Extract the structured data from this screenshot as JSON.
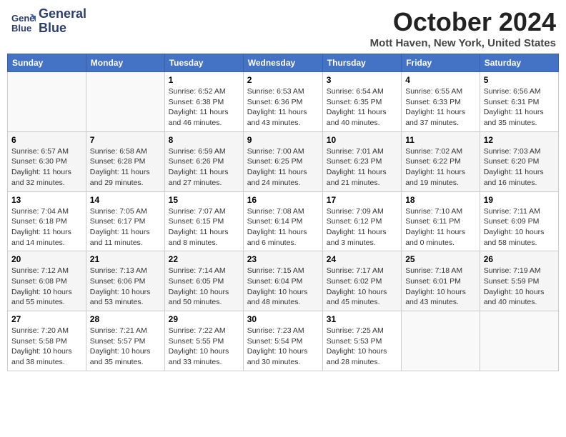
{
  "header": {
    "logo_line1": "General",
    "logo_line2": "Blue",
    "month": "October 2024",
    "location": "Mott Haven, New York, United States"
  },
  "days_of_week": [
    "Sunday",
    "Monday",
    "Tuesday",
    "Wednesday",
    "Thursday",
    "Friday",
    "Saturday"
  ],
  "weeks": [
    [
      {
        "day": "",
        "sunrise": "",
        "sunset": "",
        "daylight": ""
      },
      {
        "day": "",
        "sunrise": "",
        "sunset": "",
        "daylight": ""
      },
      {
        "day": "1",
        "sunrise": "Sunrise: 6:52 AM",
        "sunset": "Sunset: 6:38 PM",
        "daylight": "Daylight: 11 hours and 46 minutes."
      },
      {
        "day": "2",
        "sunrise": "Sunrise: 6:53 AM",
        "sunset": "Sunset: 6:36 PM",
        "daylight": "Daylight: 11 hours and 43 minutes."
      },
      {
        "day": "3",
        "sunrise": "Sunrise: 6:54 AM",
        "sunset": "Sunset: 6:35 PM",
        "daylight": "Daylight: 11 hours and 40 minutes."
      },
      {
        "day": "4",
        "sunrise": "Sunrise: 6:55 AM",
        "sunset": "Sunset: 6:33 PM",
        "daylight": "Daylight: 11 hours and 37 minutes."
      },
      {
        "day": "5",
        "sunrise": "Sunrise: 6:56 AM",
        "sunset": "Sunset: 6:31 PM",
        "daylight": "Daylight: 11 hours and 35 minutes."
      }
    ],
    [
      {
        "day": "6",
        "sunrise": "Sunrise: 6:57 AM",
        "sunset": "Sunset: 6:30 PM",
        "daylight": "Daylight: 11 hours and 32 minutes."
      },
      {
        "day": "7",
        "sunrise": "Sunrise: 6:58 AM",
        "sunset": "Sunset: 6:28 PM",
        "daylight": "Daylight: 11 hours and 29 minutes."
      },
      {
        "day": "8",
        "sunrise": "Sunrise: 6:59 AM",
        "sunset": "Sunset: 6:26 PM",
        "daylight": "Daylight: 11 hours and 27 minutes."
      },
      {
        "day": "9",
        "sunrise": "Sunrise: 7:00 AM",
        "sunset": "Sunset: 6:25 PM",
        "daylight": "Daylight: 11 hours and 24 minutes."
      },
      {
        "day": "10",
        "sunrise": "Sunrise: 7:01 AM",
        "sunset": "Sunset: 6:23 PM",
        "daylight": "Daylight: 11 hours and 21 minutes."
      },
      {
        "day": "11",
        "sunrise": "Sunrise: 7:02 AM",
        "sunset": "Sunset: 6:22 PM",
        "daylight": "Daylight: 11 hours and 19 minutes."
      },
      {
        "day": "12",
        "sunrise": "Sunrise: 7:03 AM",
        "sunset": "Sunset: 6:20 PM",
        "daylight": "Daylight: 11 hours and 16 minutes."
      }
    ],
    [
      {
        "day": "13",
        "sunrise": "Sunrise: 7:04 AM",
        "sunset": "Sunset: 6:18 PM",
        "daylight": "Daylight: 11 hours and 14 minutes."
      },
      {
        "day": "14",
        "sunrise": "Sunrise: 7:05 AM",
        "sunset": "Sunset: 6:17 PM",
        "daylight": "Daylight: 11 hours and 11 minutes."
      },
      {
        "day": "15",
        "sunrise": "Sunrise: 7:07 AM",
        "sunset": "Sunset: 6:15 PM",
        "daylight": "Daylight: 11 hours and 8 minutes."
      },
      {
        "day": "16",
        "sunrise": "Sunrise: 7:08 AM",
        "sunset": "Sunset: 6:14 PM",
        "daylight": "Daylight: 11 hours and 6 minutes."
      },
      {
        "day": "17",
        "sunrise": "Sunrise: 7:09 AM",
        "sunset": "Sunset: 6:12 PM",
        "daylight": "Daylight: 11 hours and 3 minutes."
      },
      {
        "day": "18",
        "sunrise": "Sunrise: 7:10 AM",
        "sunset": "Sunset: 6:11 PM",
        "daylight": "Daylight: 11 hours and 0 minutes."
      },
      {
        "day": "19",
        "sunrise": "Sunrise: 7:11 AM",
        "sunset": "Sunset: 6:09 PM",
        "daylight": "Daylight: 10 hours and 58 minutes."
      }
    ],
    [
      {
        "day": "20",
        "sunrise": "Sunrise: 7:12 AM",
        "sunset": "Sunset: 6:08 PM",
        "daylight": "Daylight: 10 hours and 55 minutes."
      },
      {
        "day": "21",
        "sunrise": "Sunrise: 7:13 AM",
        "sunset": "Sunset: 6:06 PM",
        "daylight": "Daylight: 10 hours and 53 minutes."
      },
      {
        "day": "22",
        "sunrise": "Sunrise: 7:14 AM",
        "sunset": "Sunset: 6:05 PM",
        "daylight": "Daylight: 10 hours and 50 minutes."
      },
      {
        "day": "23",
        "sunrise": "Sunrise: 7:15 AM",
        "sunset": "Sunset: 6:04 PM",
        "daylight": "Daylight: 10 hours and 48 minutes."
      },
      {
        "day": "24",
        "sunrise": "Sunrise: 7:17 AM",
        "sunset": "Sunset: 6:02 PM",
        "daylight": "Daylight: 10 hours and 45 minutes."
      },
      {
        "day": "25",
        "sunrise": "Sunrise: 7:18 AM",
        "sunset": "Sunset: 6:01 PM",
        "daylight": "Daylight: 10 hours and 43 minutes."
      },
      {
        "day": "26",
        "sunrise": "Sunrise: 7:19 AM",
        "sunset": "Sunset: 5:59 PM",
        "daylight": "Daylight: 10 hours and 40 minutes."
      }
    ],
    [
      {
        "day": "27",
        "sunrise": "Sunrise: 7:20 AM",
        "sunset": "Sunset: 5:58 PM",
        "daylight": "Daylight: 10 hours and 38 minutes."
      },
      {
        "day": "28",
        "sunrise": "Sunrise: 7:21 AM",
        "sunset": "Sunset: 5:57 PM",
        "daylight": "Daylight: 10 hours and 35 minutes."
      },
      {
        "day": "29",
        "sunrise": "Sunrise: 7:22 AM",
        "sunset": "Sunset: 5:55 PM",
        "daylight": "Daylight: 10 hours and 33 minutes."
      },
      {
        "day": "30",
        "sunrise": "Sunrise: 7:23 AM",
        "sunset": "Sunset: 5:54 PM",
        "daylight": "Daylight: 10 hours and 30 minutes."
      },
      {
        "day": "31",
        "sunrise": "Sunrise: 7:25 AM",
        "sunset": "Sunset: 5:53 PM",
        "daylight": "Daylight: 10 hours and 28 minutes."
      },
      {
        "day": "",
        "sunrise": "",
        "sunset": "",
        "daylight": ""
      },
      {
        "day": "",
        "sunrise": "",
        "sunset": "",
        "daylight": ""
      }
    ]
  ]
}
